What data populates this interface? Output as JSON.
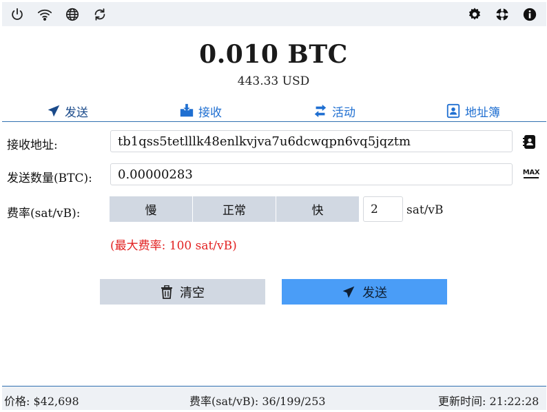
{
  "topbar": {
    "left_icons": [
      "power-icon",
      "wifi-icon",
      "globe-icon",
      "refresh-icon"
    ],
    "right_icons": [
      "settings-icon",
      "lifebuoy-icon",
      "info-icon"
    ]
  },
  "balance": {
    "amount": "0.010 BTC",
    "usd": "443.33 USD"
  },
  "tabs": [
    {
      "label": "发送",
      "icon": "send-icon"
    },
    {
      "label": "接收",
      "icon": "receive-icon"
    },
    {
      "label": "活动",
      "icon": "activity-icon"
    },
    {
      "label": "地址簿",
      "icon": "address-book-icon"
    }
  ],
  "form": {
    "address_label": "接收地址:",
    "address_value": "tb1qss5tetlllk48enlkvjva7u6dcwqpn6vq5jqztm",
    "amount_label": "发送数量(BTC):",
    "amount_value": "0.00000283",
    "max_label": "MAX",
    "fee_label": "费率(sat/vB):",
    "fee_options": [
      "慢",
      "正常",
      "快"
    ],
    "fee_value": "2",
    "fee_unit": "sat/vB",
    "max_fee": "(最大费率: 100 sat/vB)"
  },
  "actions": {
    "clear_label": "清空",
    "send_label": "发送"
  },
  "status": {
    "price": "价格: $42,698",
    "fee_rates": "费率(sat/vB): 36/199/253",
    "updated": "更新时间: 21:22:28"
  },
  "colors": {
    "accent": "#4a9df7",
    "tab_text": "#1f6fd1",
    "error": "#e22222",
    "bar_bg": "#eef1f5",
    "button_grey": "#d1d8e2"
  }
}
